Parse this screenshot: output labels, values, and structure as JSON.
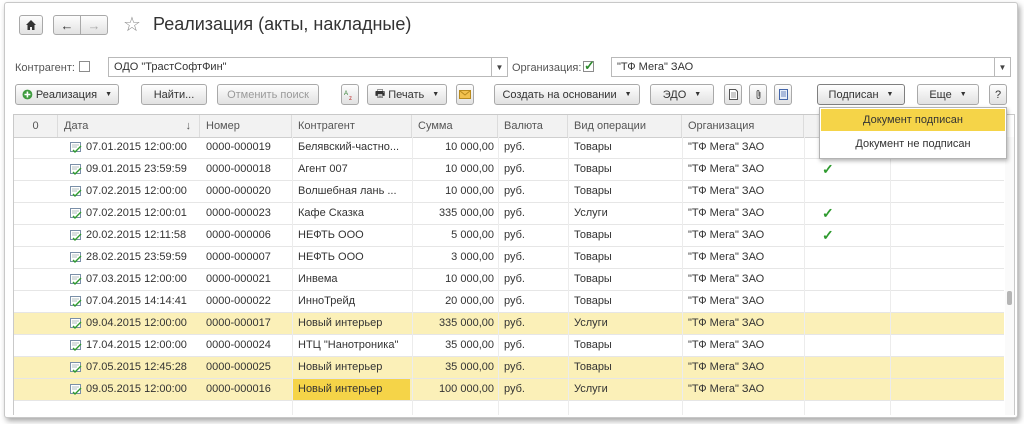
{
  "window": {
    "title": "Реализация (акты, накладные)"
  },
  "filters": {
    "contractor_label": "Контрагент:",
    "contractor_value": "ОДО \"ТрастСофтФин\"",
    "org_label": "Организация:",
    "org_value": "\"ТФ Мега\" ЗАО"
  },
  "toolbar": {
    "realization": "Реализация",
    "find": "Найти...",
    "cancel_search": "Отменить поиск",
    "print": "Печать",
    "create_based": "Создать на основании",
    "edo": "ЭДО",
    "signed_filter": "Подписан",
    "more": "Еще",
    "help": "?"
  },
  "columns": {
    "attach": "0",
    "date": "Дата",
    "sort": "↓",
    "number": "Номер",
    "contractor": "Контрагент",
    "sum": "Сумма",
    "currency": "Валюта",
    "op_type": "Вид операции",
    "org": "Организация"
  },
  "rows": [
    {
      "date": "07.01.2015 12:00:00",
      "number": "0000-000019",
      "contractor": "Белявский-частно...",
      "sum": "10 000,00",
      "currency": "руб.",
      "op": "Товары",
      "org": "\"ТФ Мега\" ЗАО",
      "signed": false,
      "hl": false
    },
    {
      "date": "09.01.2015 23:59:59",
      "number": "0000-000018",
      "contractor": "Агент 007",
      "sum": "10 000,00",
      "currency": "руб.",
      "op": "Товары",
      "org": "\"ТФ Мега\" ЗАО",
      "signed": true,
      "hl": false
    },
    {
      "date": "07.02.2015 12:00:00",
      "number": "0000-000020",
      "contractor": "Волшебная лань ...",
      "sum": "10 000,00",
      "currency": "руб.",
      "op": "Товары",
      "org": "\"ТФ Мега\" ЗАО",
      "signed": false,
      "hl": false
    },
    {
      "date": "07.02.2015 12:00:01",
      "number": "0000-000023",
      "contractor": "Кафе Сказка",
      "sum": "335 000,00",
      "currency": "руб.",
      "op": "Услуги",
      "org": "\"ТФ Мега\" ЗАО",
      "signed": true,
      "hl": false
    },
    {
      "date": "20.02.2015 12:11:58",
      "number": "0000-000006",
      "contractor": "НЕФТЬ ООО",
      "sum": "5 000,00",
      "currency": "руб.",
      "op": "Товары",
      "org": "\"ТФ Мега\" ЗАО",
      "signed": true,
      "hl": false
    },
    {
      "date": "28.02.2015 23:59:59",
      "number": "0000-000007",
      "contractor": "НЕФТЬ ООО",
      "sum": "3 000,00",
      "currency": "руб.",
      "op": "Товары",
      "org": "\"ТФ Мега\" ЗАО",
      "signed": false,
      "hl": false
    },
    {
      "date": "07.03.2015 12:00:00",
      "number": "0000-000021",
      "contractor": "Инвема",
      "sum": "10 000,00",
      "currency": "руб.",
      "op": "Товары",
      "org": "\"ТФ Мега\" ЗАО",
      "signed": false,
      "hl": false
    },
    {
      "date": "07.04.2015 14:14:41",
      "number": "0000-000022",
      "contractor": "ИнноТрейд",
      "sum": "20 000,00",
      "currency": "руб.",
      "op": "Товары",
      "org": "\"ТФ Мега\" ЗАО",
      "signed": false,
      "hl": false
    },
    {
      "date": "09.04.2015 12:00:00",
      "number": "0000-000017",
      "contractor": "Новый интерьер",
      "sum": "335 000,00",
      "currency": "руб.",
      "op": "Услуги",
      "org": "\"ТФ Мега\" ЗАО",
      "signed": false,
      "hl": true
    },
    {
      "date": "17.04.2015 12:00:00",
      "number": "0000-000024",
      "contractor": "НТЦ \"Нанотроника\"",
      "sum": "35 000,00",
      "currency": "руб.",
      "op": "Товары",
      "org": "\"ТФ Мега\" ЗАО",
      "signed": false,
      "hl": false
    },
    {
      "date": "07.05.2015 12:45:28",
      "number": "0000-000025",
      "contractor": "Новый интерьер",
      "sum": "35 000,00",
      "currency": "руб.",
      "op": "Товары",
      "org": "\"ТФ Мега\" ЗАО",
      "signed": false,
      "hl": true
    },
    {
      "date": "09.05.2015 12:00:00",
      "number": "0000-000016",
      "contractor": "Новый интерьер",
      "sum": "100 000,00",
      "currency": "руб.",
      "op": "Услуги",
      "org": "\"ТФ Мега\" ЗАО",
      "signed": false,
      "hl": true,
      "selected": true
    }
  ],
  "popup": {
    "items": [
      "Документ подписан",
      "Документ не подписан"
    ]
  },
  "colors": {
    "highlight_row": "#fbf0b8",
    "selected": "#f5d448",
    "check": "#2e9a2e"
  }
}
